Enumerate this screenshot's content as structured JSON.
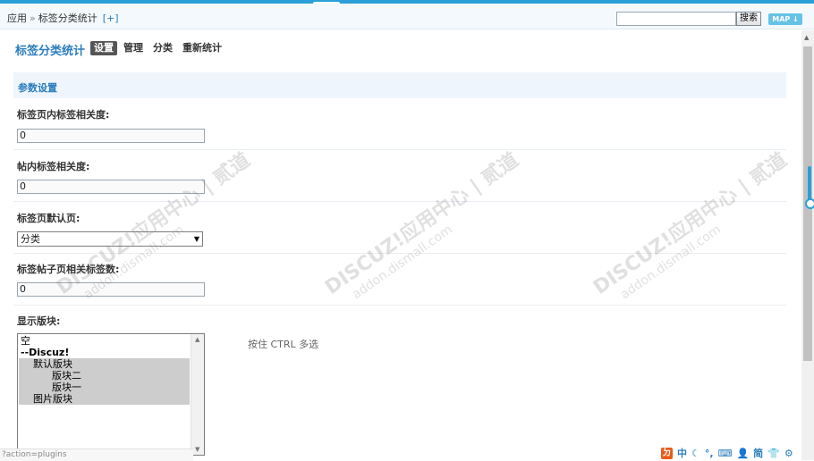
{
  "breadcrumb": {
    "app": "应用",
    "separator": "»",
    "current": "标签分类统计",
    "add": "[+]"
  },
  "search": {
    "button_label": "搜索",
    "map_label": "MAP ↓"
  },
  "page": {
    "title": "标签分类统计"
  },
  "tabs": [
    {
      "label": "设置",
      "active": true
    },
    {
      "label": "管理"
    },
    {
      "label": "分类"
    },
    {
      "label": "重新统计"
    }
  ],
  "section": {
    "title": "参数设置"
  },
  "fields": {
    "relevance": {
      "label": "标签页内标签相关度:",
      "value": "0"
    },
    "thread_relevance": {
      "label": "帖内标签相关度:",
      "value": "0"
    },
    "default_page": {
      "label": "标签页默认页:",
      "value": "分类"
    },
    "related_count": {
      "label": "标签帖子页相关标签数:",
      "value": "0"
    },
    "blocks": {
      "label": "显示版块:",
      "hint": "按住 CTRL 多选",
      "options": [
        {
          "label": "空",
          "selected": false,
          "group": false
        },
        {
          "label": "--Discuz!",
          "selected": false,
          "group": true
        },
        {
          "label": "    默认版块",
          "selected": true,
          "group": false
        },
        {
          "label": "          版块二",
          "selected": true,
          "group": false
        },
        {
          "label": "          版块一",
          "selected": true,
          "group": false
        },
        {
          "label": "    图片版块",
          "selected": true,
          "group": false
        }
      ]
    }
  },
  "status_bar": {
    "text": "?action=plugins"
  },
  "ime_toolbar": {
    "logo": "ㄉ",
    "lang": "中",
    "mode": "简"
  },
  "watermark": {
    "brand": "DISCUZ!应用中心 | 贰道",
    "url": "addon.dismall.com"
  },
  "colors": {
    "accent": "#2b7dbc",
    "stripe": "#2b9fd8",
    "tab_active": "#555555",
    "section_bg": "#eef5fc"
  }
}
